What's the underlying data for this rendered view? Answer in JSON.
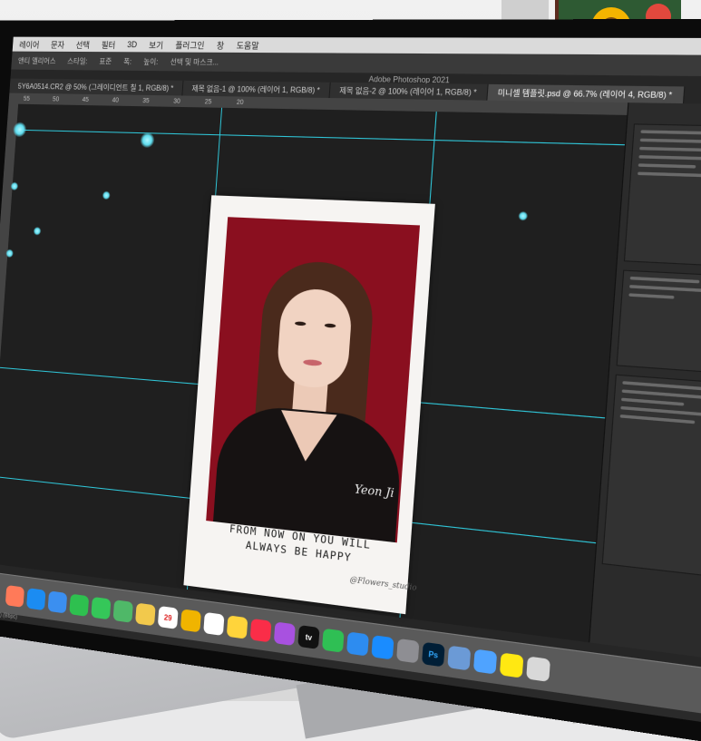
{
  "app": {
    "window_title": "Adobe Photoshop 2021"
  },
  "menubar": {
    "items": [
      "레이어",
      "문자",
      "선택",
      "필터",
      "3D",
      "보기",
      "플러그인",
      "창",
      "도움말"
    ]
  },
  "options_bar": {
    "items": [
      "앤티 앨리어스",
      "스타일:",
      "표준",
      "폭:",
      "높이:",
      "선택 및 마스크..."
    ]
  },
  "tabs": [
    {
      "label": "5Y6A0514.CR2 @ 50% (그레이디언트 칠 1, RGB/8) *",
      "active": false
    },
    {
      "label": "제목 없음-1 @ 100% (레이어 1, RGB/8) *",
      "active": false
    },
    {
      "label": "제목 없음-2 @ 100% (레이어 1, RGB/8) *",
      "active": false
    },
    {
      "label": "미니셀 템플릿.psd @ 66.7% (레이어 4, RGB/8) *",
      "active": true
    }
  ],
  "ruler": {
    "ticks": [
      "55",
      "50",
      "45",
      "40",
      "35",
      "30",
      "25",
      "20"
    ]
  },
  "document": {
    "signature": "Yeon Ji",
    "caption_line1": "FROM NOW ON YOU WILL",
    "caption_line2": "ALWAYS BE HAPPY",
    "watermark": "@Flowers_studio",
    "background_color": "#8a0f1f"
  },
  "status_bar": {
    "text": "RGB (16Bit) (Bbpc)"
  },
  "dock": {
    "icons": [
      {
        "name": "launchpad-icon",
        "color": "#ff7a59"
      },
      {
        "name": "safari-icon",
        "color": "#1b8cf2"
      },
      {
        "name": "mail-icon",
        "color": "#3b8ff0"
      },
      {
        "name": "facetime-icon",
        "color": "#2ec04f"
      },
      {
        "name": "messages-icon",
        "color": "#35c759"
      },
      {
        "name": "maps-icon",
        "color": "#4fb868"
      },
      {
        "name": "photos-icon",
        "color": "#f2c94c"
      },
      {
        "name": "calendar-icon",
        "color": "#ffffff",
        "label": "29"
      },
      {
        "name": "chrome-icon",
        "color": "#f0b400"
      },
      {
        "name": "reminders-icon",
        "color": "#ffffff"
      },
      {
        "name": "notes-icon",
        "color": "#ffd43b"
      },
      {
        "name": "music-icon",
        "color": "#fa2d48"
      },
      {
        "name": "podcasts-icon",
        "color": "#a851e0"
      },
      {
        "name": "appletv-icon",
        "color": "#111111",
        "label": "tv"
      },
      {
        "name": "numbers-icon",
        "color": "#2fbf54"
      },
      {
        "name": "keynote-icon",
        "color": "#2d8cf0"
      },
      {
        "name": "appstore-icon",
        "color": "#1a8cff"
      },
      {
        "name": "settings-icon",
        "color": "#8e8e93"
      },
      {
        "name": "photoshop-icon",
        "color": "#001e36",
        "label": "Ps"
      },
      {
        "name": "preview-icon",
        "color": "#6b9ad6"
      },
      {
        "name": "finder-icon",
        "color": "#4fa3ff"
      },
      {
        "name": "kakaotalk-icon",
        "color": "#ffe812"
      },
      {
        "name": "trash-icon",
        "color": "#d8d8d8"
      }
    ]
  }
}
